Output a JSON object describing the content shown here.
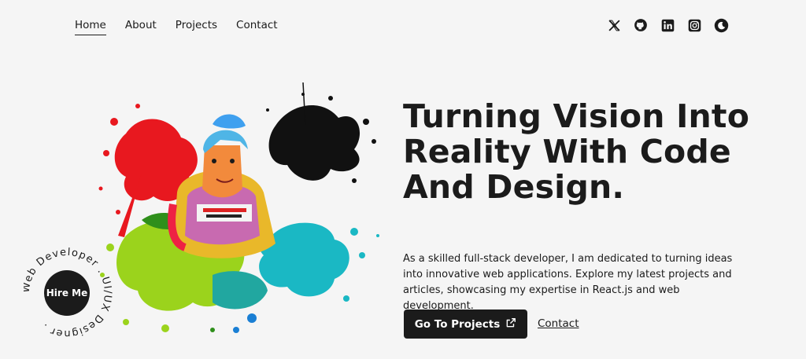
{
  "nav": {
    "items": [
      {
        "label": "Home",
        "active": true
      },
      {
        "label": "About",
        "active": false
      },
      {
        "label": "Projects",
        "active": false
      },
      {
        "label": "Contact",
        "active": false
      }
    ]
  },
  "socials": [
    "x-icon",
    "github-icon",
    "linkedin-icon",
    "instagram-icon",
    "theme-toggle-icon"
  ],
  "hire": {
    "button_label": "Hire Me",
    "ring_text": "Web Developer . UI/UX Designer ."
  },
  "hero": {
    "title": "Turning Vision Into Reality With Code And Design.",
    "description": "As a skilled full-stack developer, I am dedicated to turning ideas into innovative web applications. Explore my latest projects and articles, showcasing my expertise in React.js and web development.",
    "primary_cta": "Go To Projects",
    "secondary_cta": "Contact"
  },
  "colors": {
    "background": "#f5f5f5",
    "text": "#1b1b1b",
    "button_bg": "#1b1b1b",
    "splash_red": "#e8181f",
    "splash_green": "#9bd31c",
    "splash_teal": "#1ab8c4",
    "splash_black": "#111111"
  }
}
